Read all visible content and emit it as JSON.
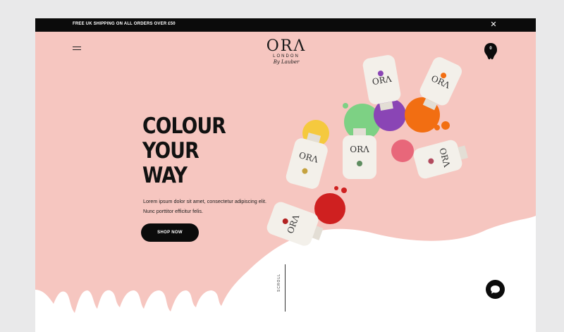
{
  "announcement": {
    "text": "FREE UK SHIPPING ON ALL ORDERS OVER £50"
  },
  "brand": {
    "mark": "ORΛ",
    "sub": "LONDON",
    "script": "By Lauber"
  },
  "cart": {
    "count": "0"
  },
  "hero": {
    "headline": [
      "COLOUR",
      "YOUR",
      "WAY"
    ],
    "body": "Lorem ipsum dolor sit amet, consectetur adipiscing elit. Nunc porttitor efficitur felis.",
    "cta": "SHOP NOW"
  },
  "scroll": {
    "label": "SCROLL"
  },
  "colors": {
    "background": "#f6c6c0",
    "accent": "#0b0b0b",
    "polish": [
      "#f5c93e",
      "#7dd184",
      "#8a45b5",
      "#f26e12",
      "#e8677a",
      "#cf2020"
    ]
  },
  "icons": {
    "close": "close-icon",
    "menu": "hamburger-icon",
    "cart": "bag-icon",
    "chat": "chat-icon"
  }
}
